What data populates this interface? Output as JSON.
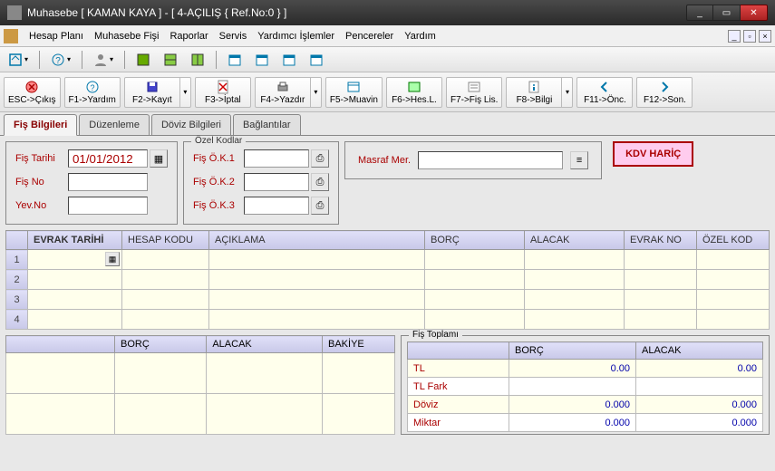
{
  "window": {
    "title": "Muhasebe [ KAMAN KAYA ]  -  [ 4-AÇILIŞ { Ref.No:0 } ]"
  },
  "menu": {
    "hesap_plani": "Hesap Planı",
    "muhasebe_fisi": "Muhasebe Fişi",
    "raporlar": "Raporlar",
    "servis": "Servis",
    "yardimci": "Yardımcı İşlemler",
    "pencereler": "Pencereler",
    "yardim": "Yardım"
  },
  "fn": {
    "esc": "ESC->Çıkış",
    "f1": "F1->Yardım",
    "f2": "F2->Kayıt",
    "f3": "F3->İptal",
    "f4": "F4->Yazdır",
    "f5": "F5->Muavin",
    "f6": "F6->Hes.L.",
    "f7": "F7->Fiş Lis.",
    "f8": "F8->Bilgi",
    "f11": "F11->Önc.",
    "f12": "F12->Son."
  },
  "tabs": {
    "fis_bilgileri": "Fiş Bilgileri",
    "duzenleme": "Düzenleme",
    "doviz": "Döviz Bilgileri",
    "baglantilar": "Bağlantılar"
  },
  "form": {
    "fis_tarihi_lbl": "Fiş Tarihi",
    "fis_tarihi_val": "01/01/2012",
    "fis_no_lbl": "Fiş No",
    "fis_no_val": "",
    "yev_no_lbl": "Yev.No",
    "yev_no_val": ""
  },
  "ozel": {
    "legend": "Özel Kodlar",
    "ok1_lbl": "Fiş Ö.K.1",
    "ok1_val": "",
    "ok2_lbl": "Fiş Ö.K.2",
    "ok2_val": "",
    "ok3_lbl": "Fiş Ö.K.3",
    "ok3_val": ""
  },
  "masraf": {
    "lbl": "Masraf Mer.",
    "val": ""
  },
  "kdv": "KDV HARİÇ",
  "grid": {
    "cols": {
      "evrak_tarihi": "EVRAK TARİHİ",
      "hesap_kodu": "HESAP KODU",
      "aciklama": "AÇIKLAMA",
      "borc": "BORÇ",
      "alacak": "ALACAK",
      "evrak_no": "EVRAK NO",
      "ozel_kod": "ÖZEL KOD"
    },
    "rows": [
      "1",
      "2",
      "3",
      "4"
    ]
  },
  "sumleft": {
    "borc": "BORÇ",
    "alacak": "ALACAK",
    "bakiye": "BAKİYE"
  },
  "fistop": {
    "legend": "Fiş Toplamı",
    "borc": "BORÇ",
    "alacak": "ALACAK",
    "rows": [
      {
        "lbl": "TL",
        "borc": "0.00",
        "alacak": "0.00"
      },
      {
        "lbl": "TL Fark",
        "borc": "",
        "alacak": ""
      },
      {
        "lbl": "Döviz",
        "borc": "0.000",
        "alacak": "0.000"
      },
      {
        "lbl": "Miktar",
        "borc": "0.000",
        "alacak": "0.000"
      }
    ]
  }
}
